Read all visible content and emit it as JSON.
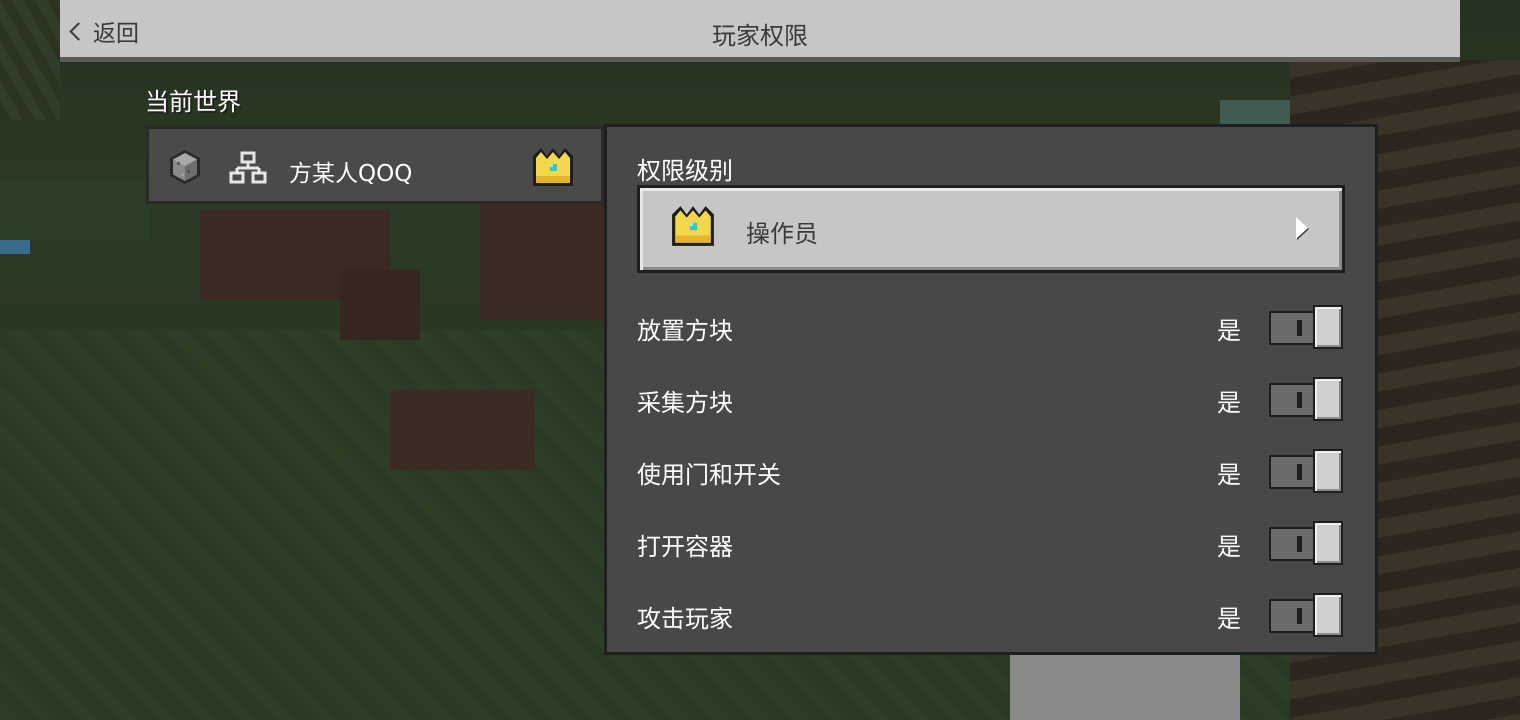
{
  "header": {
    "back_label": "返回",
    "title": "玩家权限"
  },
  "section": {
    "current_world_label": "当前世界"
  },
  "player": {
    "name": "方某人QOQ",
    "avatar_icon": "stone-block-icon",
    "connection_icon": "network-icon",
    "role_icon": "crown-icon"
  },
  "permission_level": {
    "label": "权限级别",
    "value": "操作员",
    "icon": "crown-icon"
  },
  "permissions": [
    {
      "label": "放置方块",
      "state": "是",
      "enabled": true
    },
    {
      "label": "采集方块",
      "state": "是",
      "enabled": true
    },
    {
      "label": "使用门和开关",
      "state": "是",
      "enabled": true
    },
    {
      "label": "打开容器",
      "state": "是",
      "enabled": true
    },
    {
      "label": "攻击玩家",
      "state": "是",
      "enabled": true
    }
  ],
  "colors": {
    "header_bg": "#c6c6c6",
    "panel_bg": "#484848",
    "crown_gold": "#f4d84a",
    "crown_gem": "#33c8c8"
  }
}
